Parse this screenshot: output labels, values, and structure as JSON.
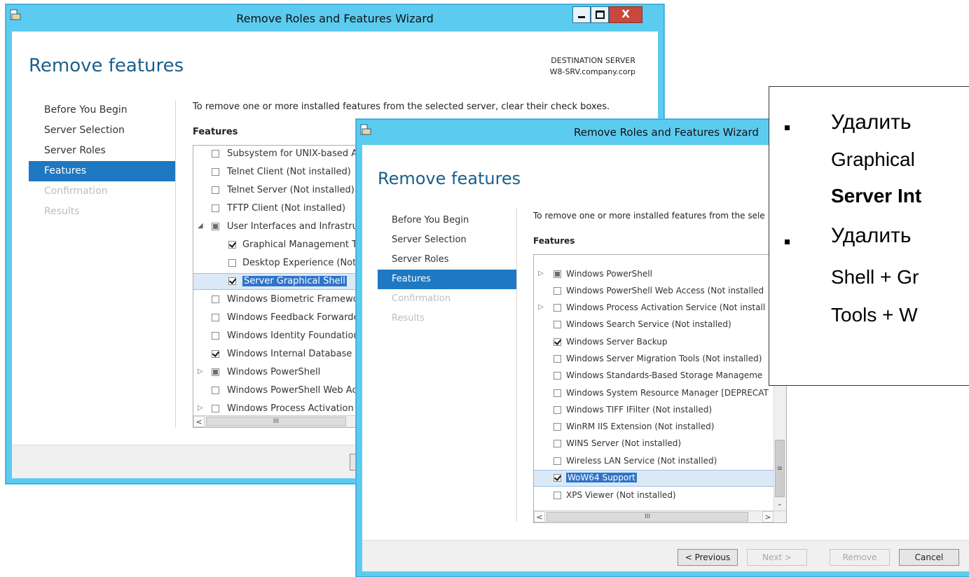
{
  "back_window": {
    "title": "Remove Roles and Features Wizard",
    "controls": {
      "minimize": "–",
      "maximize": "□",
      "close": "X"
    },
    "heading": "Remove features",
    "destination_label": "DESTINATION SERVER",
    "destination_server": "W8-SRV.company.corp",
    "nav": [
      "Before You Begin",
      "Server Selection",
      "Server Roles",
      "Features",
      "Confirmation",
      "Results"
    ],
    "instructions": "To remove one or more installed features from the selected server, clear their check boxes.",
    "features_label": "Features",
    "features": [
      {
        "label": "Subsystem for UNIX-based A",
        "check": "none"
      },
      {
        "label": "Telnet Client (Not installed)",
        "check": "none"
      },
      {
        "label": "Telnet Server (Not installed)",
        "check": "none"
      },
      {
        "label": "TFTP Client (Not installed)",
        "check": "none"
      },
      {
        "label": "User Interfaces and Infrastruc",
        "check": "partial"
      },
      {
        "label": "Graphical Management T",
        "check": "checked"
      },
      {
        "label": "Desktop Experience (Not",
        "check": "none"
      },
      {
        "label": "Server Graphical Shell",
        "check": "checked"
      },
      {
        "label": "Windows Biometric Framewo",
        "check": "none"
      },
      {
        "label": "Windows Feedback Forwarde",
        "check": "none"
      },
      {
        "label": "Windows Identity Foundation",
        "check": "none"
      },
      {
        "label": "Windows Internal Database",
        "check": "checked"
      },
      {
        "label": "Windows PowerShell",
        "check": "partial"
      },
      {
        "label": "Windows PowerShell Web Ac",
        "check": "none"
      },
      {
        "label": "Windows Process Activation",
        "check": "none"
      }
    ],
    "scroll_thumb": "III"
  },
  "front_window": {
    "title": "Remove Roles and Features Wizard",
    "heading": "Remove features",
    "nav": [
      "Before You Begin",
      "Server Selection",
      "Server Roles",
      "Features",
      "Confirmation",
      "Results"
    ],
    "instructions": "To remove one or more installed features from the sele",
    "features_label": "Features",
    "features": [
      {
        "label": "Windows PowerShell",
        "check": "partial"
      },
      {
        "label": "Windows PowerShell Web Access (Not installed",
        "check": "none"
      },
      {
        "label": "Windows Process Activation Service (Not install",
        "check": "none"
      },
      {
        "label": "Windows Search Service (Not installed)",
        "check": "none"
      },
      {
        "label": "Windows Server Backup",
        "check": "checked"
      },
      {
        "label": "Windows Server Migration Tools (Not installed)",
        "check": "none"
      },
      {
        "label": "Windows Standards-Based Storage Manageme",
        "check": "none"
      },
      {
        "label": "Windows System Resource Manager [DEPRECAT",
        "check": "none"
      },
      {
        "label": "Windows TIFF IFilter (Not installed)",
        "check": "none"
      },
      {
        "label": "WinRM IIS Extension (Not installed)",
        "check": "none"
      },
      {
        "label": "WINS Server (Not installed)",
        "check": "none"
      },
      {
        "label": "Wireless LAN Service (Not installed)",
        "check": "none"
      },
      {
        "label": "WoW64 Support",
        "check": "checked"
      },
      {
        "label": "XPS Viewer (Not installed)",
        "check": "none"
      }
    ],
    "scroll_thumb": "III",
    "vscroll_thumb": "≡",
    "buttons": {
      "previous": "< Previous",
      "next": "Next >",
      "remove": "Remove",
      "cancel": "Cancel"
    }
  },
  "callout": {
    "lines": [
      "Удалить",
      "Graphical",
      "Server Int",
      "Удалить",
      "Shell + Gr",
      "Tools + W"
    ]
  }
}
